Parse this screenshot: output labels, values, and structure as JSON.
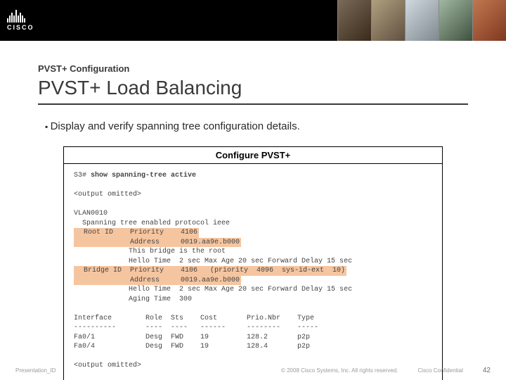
{
  "logo_text": "CISCO",
  "kicker": "PVST+ Configuration",
  "title": "PVST+ Load Balancing",
  "bullet": "Display and verify spanning tree configuration details.",
  "panel_title": "Configure PVST+",
  "terminal": {
    "prompt": "S3# ",
    "cmd": "show spanning-tree active",
    "omitted": "<output omitted>",
    "vlan": "VLAN0010",
    "proto": "  Spanning tree enabled protocol ieee",
    "root_label": "  Root ID    Priority    4106",
    "root_addr": "             Address     0019.aa9e.b000",
    "root_this": "             This bridge is the root",
    "root_hello": "             Hello Time  2 sec Max Age 20 sec Forward Delay 15 sec",
    "bridge_label": "  Bridge ID  Priority    4106   (priority  4096  sys-id-ext  10)",
    "bridge_addr": "             Address     0019.aa9e.b000",
    "bridge_hello": "             Hello Time  2 sec Max Age 20 sec Forward Delay 15 sec",
    "bridge_aging": "             Aging Time  300",
    "hdr": "Interface        Role  Sts    Cost       Prio.Nbr    Type",
    "sep": "----------       ----  ----   ------     --------    -----",
    "row1": "Fa0/1            Desg  FWD    19         128.2       p2p",
    "row2": "Fa0/4            Desg  FWD    19         128.4       p2p"
  },
  "footer_left": "Presentation_ID",
  "footer_center": "© 2008 Cisco Systems, Inc. All rights reserved.",
  "footer_conf": "Cisco Confidential",
  "page_number": "42"
}
